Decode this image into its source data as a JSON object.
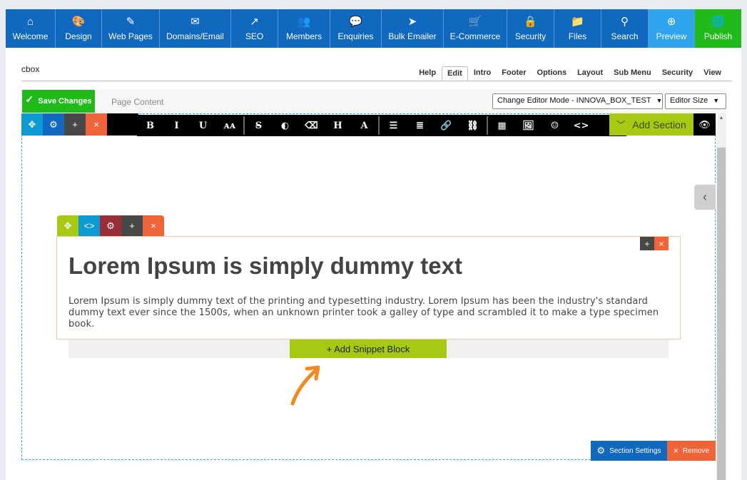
{
  "nav": [
    {
      "label": "Welcome",
      "icon": "home-icon",
      "glyph": "⌂",
      "w": 70
    },
    {
      "label": "Design",
      "icon": "palette-icon",
      "glyph": "🎨",
      "w": 65
    },
    {
      "label": "Web Pages",
      "icon": "pencil-icon",
      "glyph": "✎",
      "w": 81
    },
    {
      "label": "Domains/Email",
      "icon": "envelope-icon",
      "glyph": "✉",
      "w": 100
    },
    {
      "label": "SEO",
      "icon": "trend-up-icon",
      "glyph": "↗",
      "w": 66
    },
    {
      "label": "Members",
      "icon": "users-icon",
      "glyph": "👥",
      "w": 73
    },
    {
      "label": "Enquiries",
      "icon": "chat-icon",
      "glyph": "💬",
      "w": 72
    },
    {
      "label": "Bulk Emailer",
      "icon": "paper-plane-icon",
      "glyph": "➤",
      "w": 87
    },
    {
      "label": "E-Commerce",
      "icon": "cart-icon",
      "glyph": "🛒",
      "w": 89
    },
    {
      "label": "Security",
      "icon": "lock-icon",
      "glyph": "🔒",
      "w": 66
    },
    {
      "label": "Files",
      "icon": "folder-icon",
      "glyph": "📁",
      "w": 66
    },
    {
      "label": "Search",
      "icon": "search-icon",
      "glyph": "⚲",
      "w": 66
    },
    {
      "label": "Preview",
      "icon": "zoom-in-icon",
      "glyph": "⊕",
      "w": 65
    },
    {
      "label": "Publish",
      "icon": "globe-icon",
      "glyph": "🌐",
      "w": 65
    }
  ],
  "page_name": "cbox",
  "tabs": [
    "Help",
    "Edit",
    "Intro",
    "Footer",
    "Options",
    "Layout",
    "Sub Menu",
    "Security",
    "View"
  ],
  "active_tab": "Edit",
  "toolbar": {
    "save_label": "Save Changes",
    "page_content_label": "Page Content",
    "editor_mode": "Change Editor Mode - INNOVA_BOX_TEST",
    "editor_size": "Editor Size"
  },
  "format_buttons": [
    {
      "name": "bold-icon",
      "glyph": "B"
    },
    {
      "name": "italic-icon",
      "glyph": "I"
    },
    {
      "name": "underline-icon",
      "glyph": "U"
    },
    {
      "name": "font-size-icon",
      "glyph": "ᴀᴀ"
    },
    {
      "sep": true
    },
    {
      "name": "strikethrough-icon",
      "glyph": "S̶"
    },
    {
      "name": "contrast-icon",
      "glyph": "◐"
    },
    {
      "name": "eraser-icon",
      "glyph": "⌫"
    },
    {
      "name": "heading-icon",
      "glyph": "H"
    },
    {
      "name": "text-color-icon",
      "glyph": "A"
    },
    {
      "sep": true
    },
    {
      "name": "align-icon",
      "glyph": "☰"
    },
    {
      "name": "list-icon",
      "glyph": "≣"
    },
    {
      "name": "link-icon",
      "glyph": "🔗"
    },
    {
      "name": "unlink-icon",
      "glyph": "⛓"
    },
    {
      "sep": true
    },
    {
      "name": "table-icon",
      "glyph": "▦"
    },
    {
      "name": "image-icon",
      "glyph": "🖼"
    },
    {
      "name": "emoji-icon",
      "glyph": "☺"
    },
    {
      "name": "code-icon",
      "glyph": "<>"
    }
  ],
  "add_section_label": "Add Section",
  "content": {
    "heading": "Lorem Ipsum is simply dummy text",
    "paragraph": "Lorem Ipsum is simply dummy text of the printing and typesetting industry. Lorem Ipsum has been the industry's standard dummy text ever since the 1500s, when an unknown printer took a galley of type and scrambled it to make a type specimen book."
  },
  "add_snippet_label": "+ Add Snippet Block",
  "section_settings_label": "Section Settings",
  "remove_label": "Remove",
  "colors": {
    "nav_blue": "#1168bf",
    "preview_blue": "#2ea5ec",
    "publish_green": "#20ba1a",
    "lime": "#a7c912",
    "orange": "#f0643a",
    "cyan": "#0b9ad1",
    "maroon": "#9a2e36",
    "dark_gray": "#474747"
  }
}
